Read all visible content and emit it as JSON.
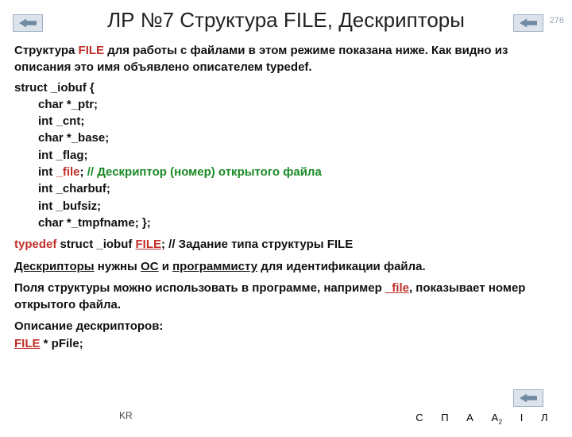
{
  "page_number": "276",
  "title": "ЛР №7 Структура FILE, Дескрипторы",
  "intro": {
    "part1": "Структура ",
    "file_kw": "FILE",
    "part2": " для работы с файлами в этом режиме показана ниже. Как видно из описания это имя объявлено описателем typedef."
  },
  "struct_header": "struct _iobuf {",
  "fields": {
    "ptr": "char *_ptr;",
    "cnt": "int   _cnt;",
    "base": "char *_base;",
    "flag": "int   _flag;",
    "file_prefix": "int   ",
    "file_name": "_file",
    "file_semicolon": "; ",
    "file_comment": "// Дескриптор (номер) открытого файла",
    "charbuf": "int   _charbuf;",
    "bufsiz": "int   _bufsiz;",
    "tmpfname": "char *_tmpfname;        };"
  },
  "typedef": {
    "kw": "typedef",
    "mid": " struct _iobuf ",
    "file_kw": "FILE",
    "tail": "; // Задание типа структуры FILE"
  },
  "descriptor_sentence": {
    "p1": "Дескрипторы",
    "p2": " нужны ",
    "p3": "ОС",
    "p4": " и ",
    "p5": "программисту",
    "p6": " для идентификации файла."
  },
  "fields_sentence": {
    "p1": "Поля структуры можно использовать в программе, например ",
    "p2": "_file",
    "p3": ", показывает номер открытого файла."
  },
  "descriptor_header": "Описание дескрипторов:",
  "decl": {
    "kw": "FILE",
    "rest": " * pFile;"
  },
  "footer": {
    "kr": "KR",
    "c": "С",
    "p": "П",
    "a": "А",
    "a2": "А",
    "a2_sub": "2",
    "i": "I",
    "l": "Л"
  }
}
